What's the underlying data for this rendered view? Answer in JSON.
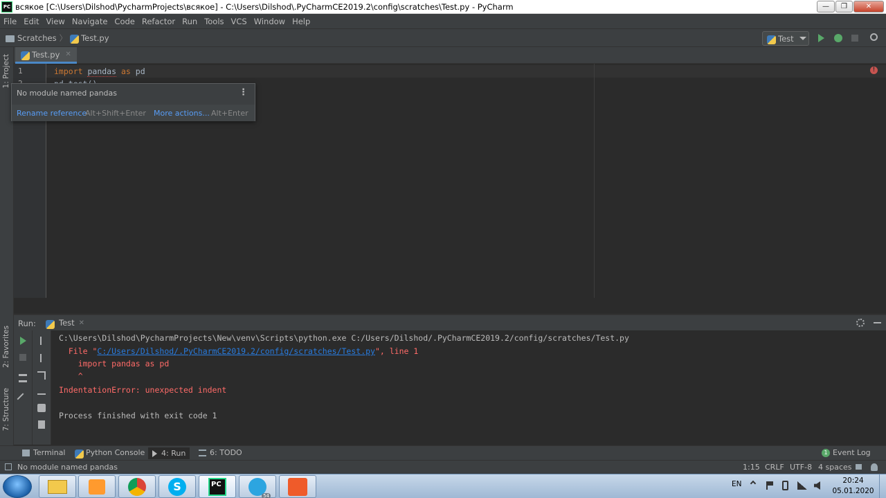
{
  "window": {
    "title": "всякое [C:\\Users\\Dilshod\\PycharmProjects\\всякое] - C:\\Users\\Dilshod\\.PyCharmCE2019.2\\config\\scratches\\Test.py - PyCharm",
    "app_icon_text": "PC",
    "minimize": "—",
    "maximize": "❐",
    "close": "✕"
  },
  "menu": [
    "File",
    "Edit",
    "View",
    "Navigate",
    "Code",
    "Refactor",
    "Run",
    "Tools",
    "VCS",
    "Window",
    "Help"
  ],
  "breadcrumb": {
    "scratches": "Scratches",
    "file": "Test.py",
    "sep": "〉"
  },
  "run_config": {
    "name": "Test"
  },
  "left_strip": {
    "project": "1: Project",
    "favorites": "2: Favorites",
    "structure": "7: Structure"
  },
  "editor": {
    "tab_label": "Test.py",
    "tab_close": "✕",
    "lines": [
      {
        "num": "1",
        "kw1": "import",
        "mod": "pandas",
        "kw2": "as",
        "alias": "pd"
      },
      {
        "num": "2",
        "text": "pd.test()"
      }
    ],
    "error_marker": "!"
  },
  "popup": {
    "message": "No module named pandas",
    "menu": "⋮",
    "action1": "Rename reference",
    "shortcut1": "Alt+Shift+Enter",
    "action2": "More actions...",
    "shortcut2": "Alt+Enter"
  },
  "run_panel": {
    "label": "Run:",
    "tab": "Test",
    "tab_close": "✕",
    "console": {
      "cmd": "C:\\Users\\Dilshod\\PycharmProjects\\New\\venv\\Scripts\\python.exe C:/Users/Dilshod/.PyCharmCE2019.2/config/scratches/Test.py",
      "file_prefix": "  File \"",
      "file_link": "C:/Users/Dilshod/.PyCharmCE2019.2/config/scratches/Test.py",
      "file_suffix": "\", line 1",
      "code_line": "    import pandas as pd",
      "caret": "    ^",
      "error": "IndentationError: unexpected indent",
      "exit": "Process finished with exit code 1"
    }
  },
  "tool_windows": {
    "terminal": "Terminal",
    "python_console": "Python Console",
    "run": "4: Run",
    "todo": "6: TODO",
    "event_log": "Event Log",
    "event_count": "1"
  },
  "status": {
    "message": "No module named pandas",
    "position": "1:15",
    "line_sep": "CRLF",
    "encoding": "UTF-8",
    "indent": "4 spaces"
  },
  "taskbar": {
    "lang": "EN",
    "time": "20:24",
    "date": "05.01.2020",
    "telegram_badge": "54"
  },
  "colors": {
    "editor_bg": "#2b2b2b",
    "panel_bg": "#3c3f41",
    "keyword": "#cc7832",
    "error": "#ff6b68",
    "link": "#287bde",
    "run_green": "#59a869"
  }
}
